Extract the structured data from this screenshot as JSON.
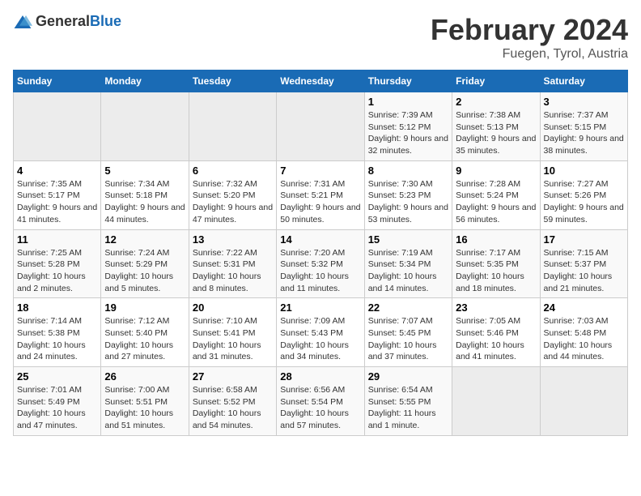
{
  "header": {
    "logo_general": "General",
    "logo_blue": "Blue",
    "month_year": "February 2024",
    "location": "Fuegen, Tyrol, Austria"
  },
  "days_of_week": [
    "Sunday",
    "Monday",
    "Tuesday",
    "Wednesday",
    "Thursday",
    "Friday",
    "Saturday"
  ],
  "weeks": [
    [
      {
        "day": "",
        "sunrise": "",
        "sunset": "",
        "daylight": ""
      },
      {
        "day": "",
        "sunrise": "",
        "sunset": "",
        "daylight": ""
      },
      {
        "day": "",
        "sunrise": "",
        "sunset": "",
        "daylight": ""
      },
      {
        "day": "",
        "sunrise": "",
        "sunset": "",
        "daylight": ""
      },
      {
        "day": "1",
        "sunrise": "Sunrise: 7:39 AM",
        "sunset": "Sunset: 5:12 PM",
        "daylight": "Daylight: 9 hours and 32 minutes."
      },
      {
        "day": "2",
        "sunrise": "Sunrise: 7:38 AM",
        "sunset": "Sunset: 5:13 PM",
        "daylight": "Daylight: 9 hours and 35 minutes."
      },
      {
        "day": "3",
        "sunrise": "Sunrise: 7:37 AM",
        "sunset": "Sunset: 5:15 PM",
        "daylight": "Daylight: 9 hours and 38 minutes."
      }
    ],
    [
      {
        "day": "4",
        "sunrise": "Sunrise: 7:35 AM",
        "sunset": "Sunset: 5:17 PM",
        "daylight": "Daylight: 9 hours and 41 minutes."
      },
      {
        "day": "5",
        "sunrise": "Sunrise: 7:34 AM",
        "sunset": "Sunset: 5:18 PM",
        "daylight": "Daylight: 9 hours and 44 minutes."
      },
      {
        "day": "6",
        "sunrise": "Sunrise: 7:32 AM",
        "sunset": "Sunset: 5:20 PM",
        "daylight": "Daylight: 9 hours and 47 minutes."
      },
      {
        "day": "7",
        "sunrise": "Sunrise: 7:31 AM",
        "sunset": "Sunset: 5:21 PM",
        "daylight": "Daylight: 9 hours and 50 minutes."
      },
      {
        "day": "8",
        "sunrise": "Sunrise: 7:30 AM",
        "sunset": "Sunset: 5:23 PM",
        "daylight": "Daylight: 9 hours and 53 minutes."
      },
      {
        "day": "9",
        "sunrise": "Sunrise: 7:28 AM",
        "sunset": "Sunset: 5:24 PM",
        "daylight": "Daylight: 9 hours and 56 minutes."
      },
      {
        "day": "10",
        "sunrise": "Sunrise: 7:27 AM",
        "sunset": "Sunset: 5:26 PM",
        "daylight": "Daylight: 9 hours and 59 minutes."
      }
    ],
    [
      {
        "day": "11",
        "sunrise": "Sunrise: 7:25 AM",
        "sunset": "Sunset: 5:28 PM",
        "daylight": "Daylight: 10 hours and 2 minutes."
      },
      {
        "day": "12",
        "sunrise": "Sunrise: 7:24 AM",
        "sunset": "Sunset: 5:29 PM",
        "daylight": "Daylight: 10 hours and 5 minutes."
      },
      {
        "day": "13",
        "sunrise": "Sunrise: 7:22 AM",
        "sunset": "Sunset: 5:31 PM",
        "daylight": "Daylight: 10 hours and 8 minutes."
      },
      {
        "day": "14",
        "sunrise": "Sunrise: 7:20 AM",
        "sunset": "Sunset: 5:32 PM",
        "daylight": "Daylight: 10 hours and 11 minutes."
      },
      {
        "day": "15",
        "sunrise": "Sunrise: 7:19 AM",
        "sunset": "Sunset: 5:34 PM",
        "daylight": "Daylight: 10 hours and 14 minutes."
      },
      {
        "day": "16",
        "sunrise": "Sunrise: 7:17 AM",
        "sunset": "Sunset: 5:35 PM",
        "daylight": "Daylight: 10 hours and 18 minutes."
      },
      {
        "day": "17",
        "sunrise": "Sunrise: 7:15 AM",
        "sunset": "Sunset: 5:37 PM",
        "daylight": "Daylight: 10 hours and 21 minutes."
      }
    ],
    [
      {
        "day": "18",
        "sunrise": "Sunrise: 7:14 AM",
        "sunset": "Sunset: 5:38 PM",
        "daylight": "Daylight: 10 hours and 24 minutes."
      },
      {
        "day": "19",
        "sunrise": "Sunrise: 7:12 AM",
        "sunset": "Sunset: 5:40 PM",
        "daylight": "Daylight: 10 hours and 27 minutes."
      },
      {
        "day": "20",
        "sunrise": "Sunrise: 7:10 AM",
        "sunset": "Sunset: 5:41 PM",
        "daylight": "Daylight: 10 hours and 31 minutes."
      },
      {
        "day": "21",
        "sunrise": "Sunrise: 7:09 AM",
        "sunset": "Sunset: 5:43 PM",
        "daylight": "Daylight: 10 hours and 34 minutes."
      },
      {
        "day": "22",
        "sunrise": "Sunrise: 7:07 AM",
        "sunset": "Sunset: 5:45 PM",
        "daylight": "Daylight: 10 hours and 37 minutes."
      },
      {
        "day": "23",
        "sunrise": "Sunrise: 7:05 AM",
        "sunset": "Sunset: 5:46 PM",
        "daylight": "Daylight: 10 hours and 41 minutes."
      },
      {
        "day": "24",
        "sunrise": "Sunrise: 7:03 AM",
        "sunset": "Sunset: 5:48 PM",
        "daylight": "Daylight: 10 hours and 44 minutes."
      }
    ],
    [
      {
        "day": "25",
        "sunrise": "Sunrise: 7:01 AM",
        "sunset": "Sunset: 5:49 PM",
        "daylight": "Daylight: 10 hours and 47 minutes."
      },
      {
        "day": "26",
        "sunrise": "Sunrise: 7:00 AM",
        "sunset": "Sunset: 5:51 PM",
        "daylight": "Daylight: 10 hours and 51 minutes."
      },
      {
        "day": "27",
        "sunrise": "Sunrise: 6:58 AM",
        "sunset": "Sunset: 5:52 PM",
        "daylight": "Daylight: 10 hours and 54 minutes."
      },
      {
        "day": "28",
        "sunrise": "Sunrise: 6:56 AM",
        "sunset": "Sunset: 5:54 PM",
        "daylight": "Daylight: 10 hours and 57 minutes."
      },
      {
        "day": "29",
        "sunrise": "Sunrise: 6:54 AM",
        "sunset": "Sunset: 5:55 PM",
        "daylight": "Daylight: 11 hours and 1 minute."
      },
      {
        "day": "",
        "sunrise": "",
        "sunset": "",
        "daylight": ""
      },
      {
        "day": "",
        "sunrise": "",
        "sunset": "",
        "daylight": ""
      }
    ]
  ]
}
